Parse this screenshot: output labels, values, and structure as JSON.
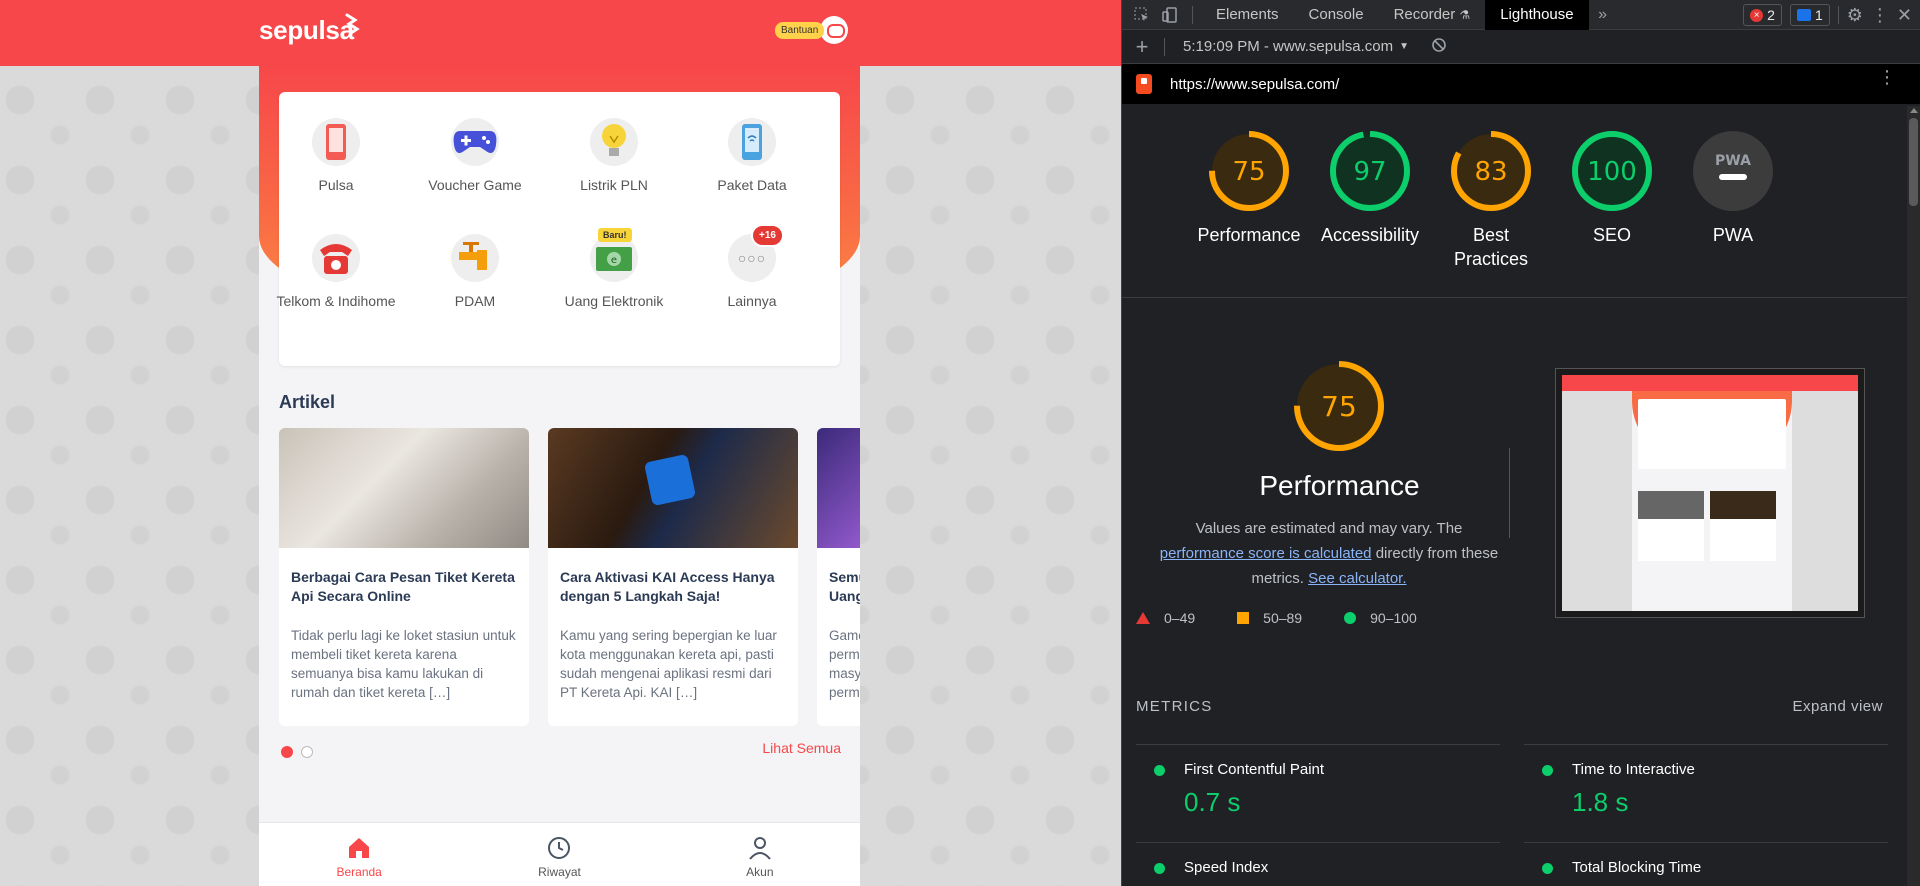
{
  "site": {
    "logo_text": "sepulsa",
    "help_label": "Bantuan",
    "services": [
      {
        "label": "Pulsa",
        "icon": "phone-icon"
      },
      {
        "label": "Voucher Game",
        "icon": "gamepad-icon"
      },
      {
        "label": "Listrik PLN",
        "icon": "lightbulb-icon"
      },
      {
        "label": "Paket Data",
        "icon": "wifi-phone-icon"
      },
      {
        "label": "Telkom & Indihome",
        "icon": "telephone-icon"
      },
      {
        "label": "PDAM",
        "icon": "water-tap-icon"
      },
      {
        "label": "Uang Elektronik",
        "icon": "e-money-icon",
        "badge": "Baru!"
      },
      {
        "label": "Lainnya",
        "icon": "more-icon",
        "badge": "+16"
      }
    ],
    "articles_title": "Artikel",
    "articles": [
      {
        "title": "Berbagai Cara Pesan Tiket Kereta Api Secara Online",
        "desc": "Tidak perlu lagi ke loket stasiun untuk membeli tiket kereta karena semuanya bisa kamu lakukan di rumah dan tiket kereta […]"
      },
      {
        "title": "Cara Aktivasi KAI Access Hanya dengan 5 Langkah Saja!",
        "desc": "Kamu yang sering bepergian ke luar kota menggunakan kereta api, pasti sudah mengenai aplikasi resmi dari PT Kereta Api. KAI […]"
      },
      {
        "title": "Semu Uang",
        "desc": "Game perm masy perm"
      }
    ],
    "see_all": "Lihat Semua",
    "nav": [
      {
        "label": "Beranda",
        "icon": "home-icon"
      },
      {
        "label": "Riwayat",
        "icon": "clock-icon"
      },
      {
        "label": "Akun",
        "icon": "user-icon"
      }
    ]
  },
  "devtools": {
    "tabs": [
      "Elements",
      "Console",
      "Recorder",
      "Lighthouse"
    ],
    "active_tab": "Lighthouse",
    "errors": "2",
    "messages": "1",
    "report_select": "5:19:09 PM - www.sepulsa.com",
    "url": "https://www.sepulsa.com/",
    "scores": [
      {
        "label": "Performance",
        "value": "75",
        "score": 75,
        "color": "#ffa400"
      },
      {
        "label": "Accessibility",
        "value": "97",
        "score": 97,
        "color": "#0cce6b"
      },
      {
        "label": "Best Practices",
        "value": "83",
        "score": 83,
        "color": "#ffa400"
      },
      {
        "label": "SEO",
        "value": "100",
        "score": 100,
        "color": "#0cce6b"
      },
      {
        "label": "PWA",
        "value": "PWA",
        "score": 0,
        "color": "#9aa0a6"
      }
    ],
    "perf": {
      "score": "75",
      "title": "Performance",
      "desc_1": "Values are estimated and may vary. The",
      "link_1": "performance score is calculated",
      "desc_2": "directly from these metrics.",
      "link_2": "See calculator."
    },
    "legend": [
      "0–49",
      "50–89",
      "90–100"
    ],
    "metrics_title": "METRICS",
    "expand": "Expand view",
    "metrics": [
      {
        "name": "First Contentful Paint",
        "value": "0.7 s"
      },
      {
        "name": "Time to Interactive",
        "value": "1.8 s"
      },
      {
        "name": "Speed Index",
        "value": ""
      },
      {
        "name": "Total Blocking Time",
        "value": ""
      }
    ]
  }
}
